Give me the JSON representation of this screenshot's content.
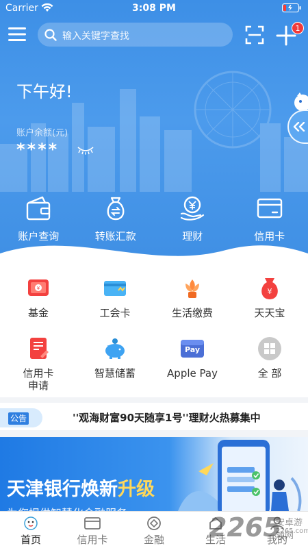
{
  "status": {
    "carrier": "Carrier",
    "time": "3:08 PM"
  },
  "header": {
    "search_placeholder": "输入关键字查找",
    "add_badge": "1"
  },
  "account": {
    "greeting": "下午好!",
    "balance_label": "账户余额(元)",
    "balance_mask": "****"
  },
  "quick_actions": [
    {
      "label": "账户查询",
      "icon": "wallet-icon"
    },
    {
      "label": "转账汇款",
      "icon": "money-bag-icon"
    },
    {
      "label": "理财",
      "icon": "wealth-hand-icon"
    },
    {
      "label": "信用卡",
      "icon": "credit-card-icon"
    }
  ],
  "services": [
    {
      "label": "基金",
      "icon": "fund-icon"
    },
    {
      "label": "工会卡",
      "icon": "union-card-icon"
    },
    {
      "label": "生活缴费",
      "icon": "life-payment-icon"
    },
    {
      "label": "天天宝",
      "icon": "tiantianbao-icon"
    },
    {
      "label": "信用卡\n申请",
      "label_line1": "信用卡",
      "label_line2": "申请",
      "icon": "card-apply-icon"
    },
    {
      "label": "智慧储蓄",
      "icon": "piggy-bank-icon"
    },
    {
      "label": "Apple Pay",
      "icon": "apple-pay-icon",
      "icon_text": "Pay"
    },
    {
      "label": "全 部",
      "icon": "all-apps-icon"
    }
  ],
  "notice": {
    "tag": "公告",
    "text": "''观海财富90天随享1号''理财火热募集中"
  },
  "banner": {
    "title_main": "天津银行焕新",
    "title_highlight": "升级",
    "subtitle": "为您提供智慧化金融服务"
  },
  "tabs": [
    {
      "label": "首页",
      "icon": "home-icon",
      "active": true
    },
    {
      "label": "信用卡",
      "icon": "card-tab-icon"
    },
    {
      "label": "金融",
      "icon": "finance-tab-icon"
    },
    {
      "label": "生活",
      "icon": "life-tab-icon"
    },
    {
      "label": "我的",
      "icon": "profile-tab-icon"
    }
  ],
  "watermark": {
    "number": "2265",
    "site": "安卓游戏网",
    "url": "2265.com"
  },
  "colors": {
    "primary": "#3d8fe6",
    "badge": "#f03a3a",
    "highlight": "#ffd85a"
  }
}
